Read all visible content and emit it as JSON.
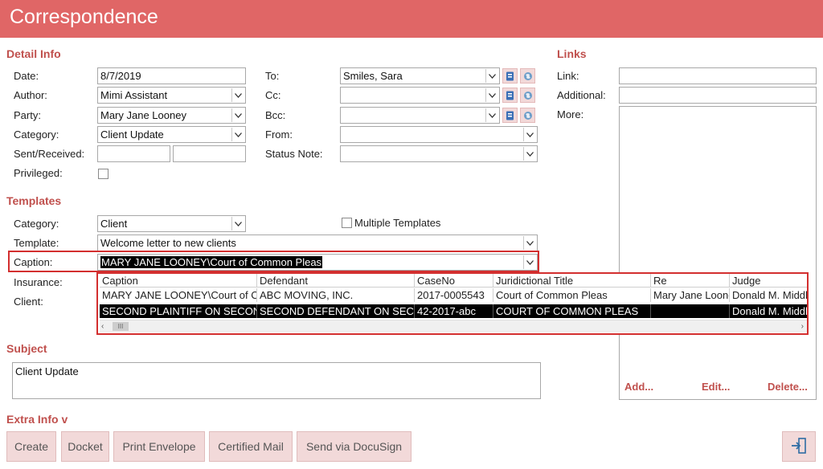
{
  "window": {
    "title": "Correspondence"
  },
  "sections": {
    "detail_info": "Detail Info",
    "links": "Links",
    "templates": "Templates",
    "subject": "Subject",
    "extra_info": "Extra Info v"
  },
  "detail": {
    "date_label": "Date:",
    "date_value": "8/7/2019",
    "author_label": "Author:",
    "author_value": "Mimi Assistant",
    "party_label": "Party:",
    "party_value": "Mary  Jane Looney",
    "category_label": "Category:",
    "category_value": "Client Update",
    "sent_label": "Sent/Received:",
    "sent_value": "",
    "received_value": "",
    "privileged_label": "Privileged:",
    "privileged_checked": false,
    "to_label": "To:",
    "to_value": "Smiles, Sara",
    "cc_label": "Cc:",
    "cc_value": "",
    "bcc_label": "Bcc:",
    "bcc_value": "",
    "from_label": "From:",
    "from_value": "",
    "status_note_label": "Status Note:",
    "status_note_value": ""
  },
  "links": {
    "link_label": "Link:",
    "link_value": "",
    "additional_label": "Additional:",
    "additional_value": "",
    "more_label": "More:",
    "more_value": "",
    "add_label": "Add...",
    "edit_label": "Edit...",
    "delete_label": "Delete..."
  },
  "templates": {
    "category_label": "Category:",
    "category_value": "Client",
    "multiple_label": "Multiple Templates",
    "multiple_checked": false,
    "template_label": "Template:",
    "template_value": "Welcome letter to new clients",
    "caption_label": "Caption:",
    "caption_value": "MARY JANE LOONEY\\Court of Common Pleas",
    "insurance_label": "Insurance:",
    "client_label": "Client:"
  },
  "caption_grid": {
    "columns": [
      "Caption",
      "Defendant",
      "CaseNo",
      "Juridictional Title",
      "Re",
      "Judge"
    ],
    "rows": [
      [
        "MARY JANE LOONEY\\Court of Common Pleas",
        "ABC MOVING, INC.",
        "2017-0005543",
        "Court of Common Pleas",
        "Mary Jane Looney",
        "Donald M. Middleton"
      ],
      [
        "SECOND PLAINTIFF ON SECOND CASE",
        "SECOND DEFENDANT ON SECOND CASE",
        "42-2017-abc",
        "COURT OF COMMON PLEAS",
        "",
        "Donald M. Middleton"
      ]
    ],
    "selected_row": 1,
    "scroll_thumb": "III"
  },
  "subject": {
    "value": "Client Update"
  },
  "buttons": {
    "create": "Create",
    "docket": "Docket",
    "print_envelope": "Print Envelope",
    "certified_mail": "Certified Mail",
    "send_docusign": "Send via DocuSign"
  },
  "colors": {
    "accent": "#e06666",
    "section": "#c0504d",
    "highlight": "#d32f2f",
    "button_bg": "#f2d9d9"
  }
}
